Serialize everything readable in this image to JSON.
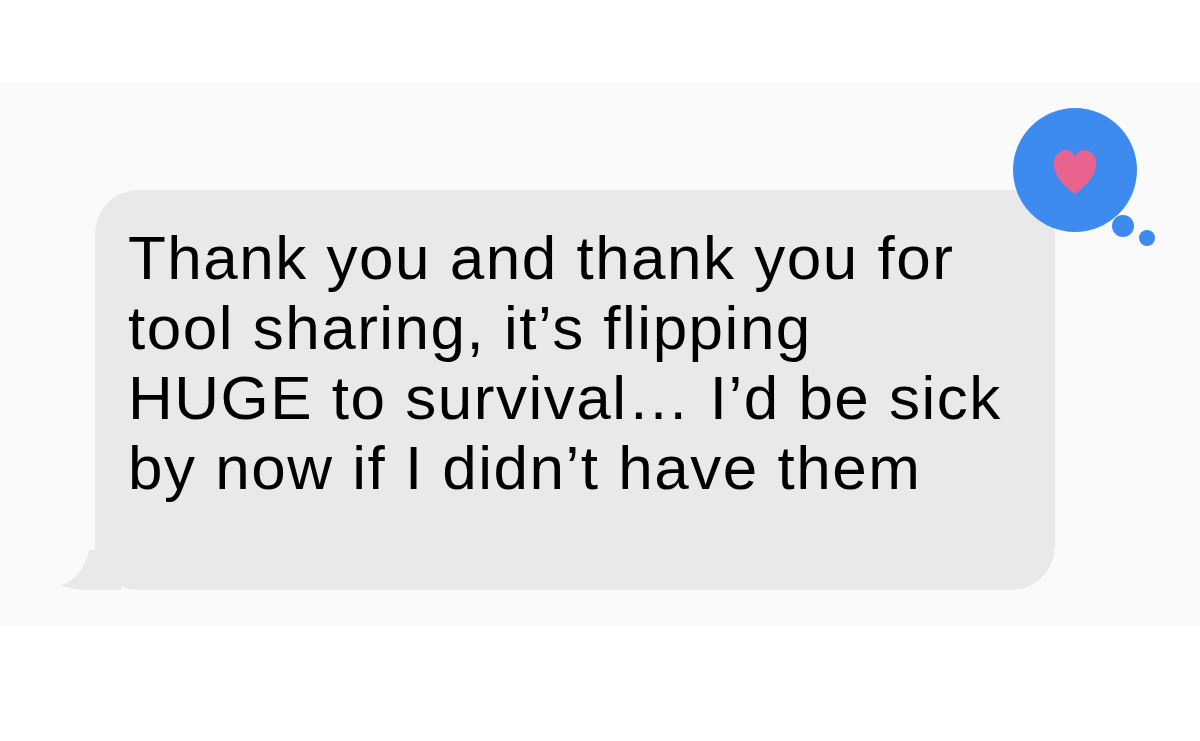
{
  "message": {
    "text": "Thank you and thank you for tool sharing, it’s flipping HUGE to survival… I’d be sick by now if I didn’t have them",
    "incoming": true,
    "tapback": {
      "kind": "heart"
    }
  }
}
